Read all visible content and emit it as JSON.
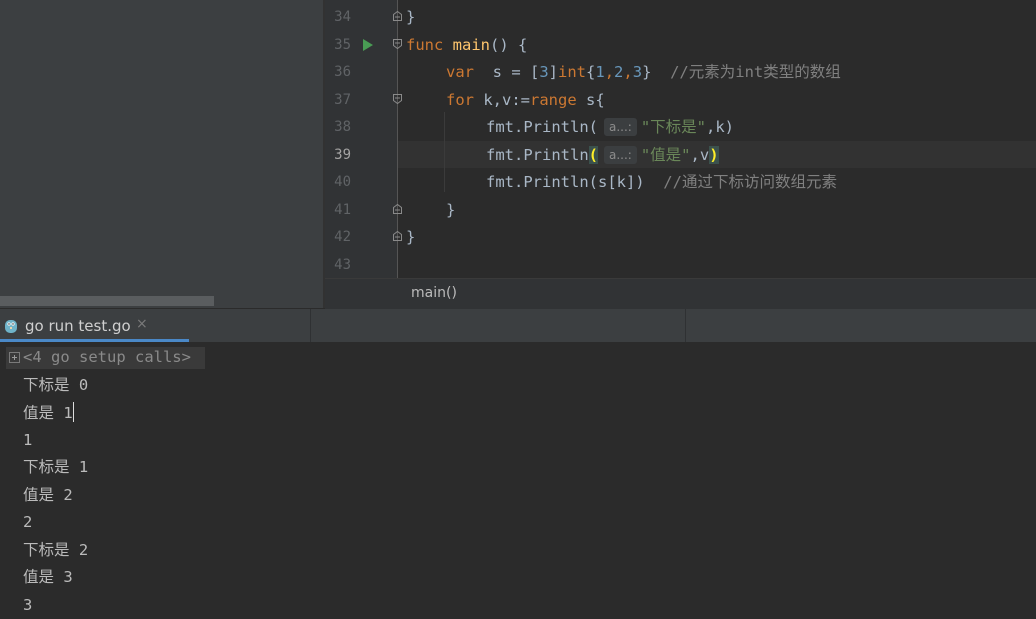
{
  "editor": {
    "line_numbers": [
      "34",
      "35",
      "36",
      "37",
      "38",
      "39",
      "40",
      "41",
      "42",
      "43"
    ],
    "current_line": "39",
    "code": {
      "l34_close": "}",
      "l35_kw": "func",
      "l35_fn": "main",
      "l35_rest": "() {",
      "l36_kw": "var",
      "l36_a": "  s = [",
      "l36_n3": "3",
      "l36_b": "]",
      "l36_int": "int",
      "l36_c": "{",
      "l36_n1": "1",
      "l36_comma1": ",",
      "l36_n2": "2",
      "l36_comma2": ",",
      "l36_n3b": "3",
      "l36_d": "}",
      "l36_comment": "  //元素为int类型的数组",
      "l37_kw": "for",
      "l37_a": " k,v:=",
      "l37_range": "range",
      "l37_b": " s{",
      "l38_a": "fmt.Println(",
      "l38_hint": "a...:",
      "l38_str": "\"下标是\"",
      "l38_b": ",k)",
      "l39_a": "fmt.Println",
      "l39_paren_open": "(",
      "l39_hint": "a...:",
      "l39_str": "\"值是\"",
      "l39_b": ",v",
      "l39_paren_close": ")",
      "l40_a": "fmt.Println(s[k])",
      "l40_comment": "  //通过下标访问数组元素",
      "l41_close": "}",
      "l42_close": "}"
    },
    "breadcrumb": "main()"
  },
  "run_panel": {
    "tab_label": "go run test.go",
    "close_glyph": "×",
    "setup_calls": "<4 go setup calls>",
    "output_lines": [
      "下标是 0",
      "值是 1",
      "1",
      "下标是 1",
      "值是 2",
      "2",
      "下标是 2",
      "值是 3",
      "3"
    ]
  },
  "colors": {
    "keyword": "#cc7832",
    "number": "#6897bb",
    "string": "#6a8759",
    "comment": "#808080",
    "function": "#ffc66d",
    "tab_accent": "#4a88c7"
  }
}
